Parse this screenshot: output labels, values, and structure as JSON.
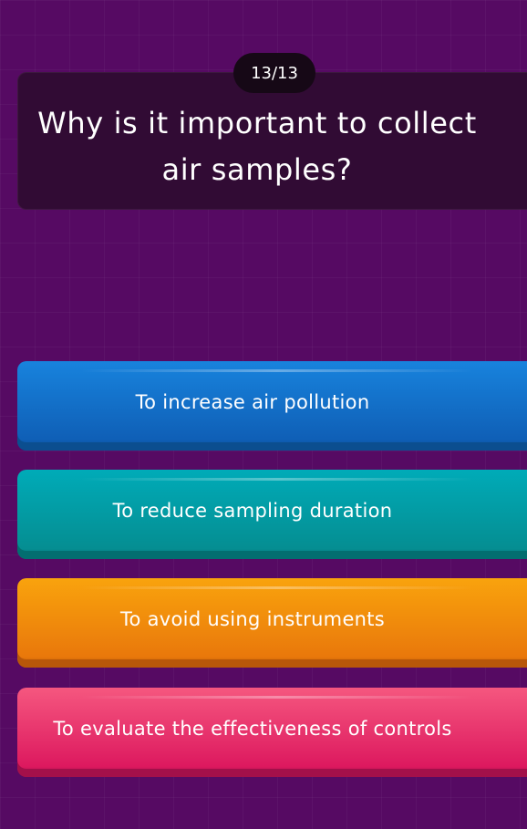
{
  "quiz": {
    "counter": "13/13",
    "question": "Why is it important to collect air samples?"
  },
  "answers": [
    {
      "label": "To increase air pollution",
      "color": "#1374cd"
    },
    {
      "label": "To reduce sampling duration",
      "color": "#009ea6"
    },
    {
      "label": "To avoid using instruments",
      "color": "#f08c0c"
    },
    {
      "label": "To evaluate the effectiveness of controls",
      "color": "#e8306c"
    }
  ]
}
